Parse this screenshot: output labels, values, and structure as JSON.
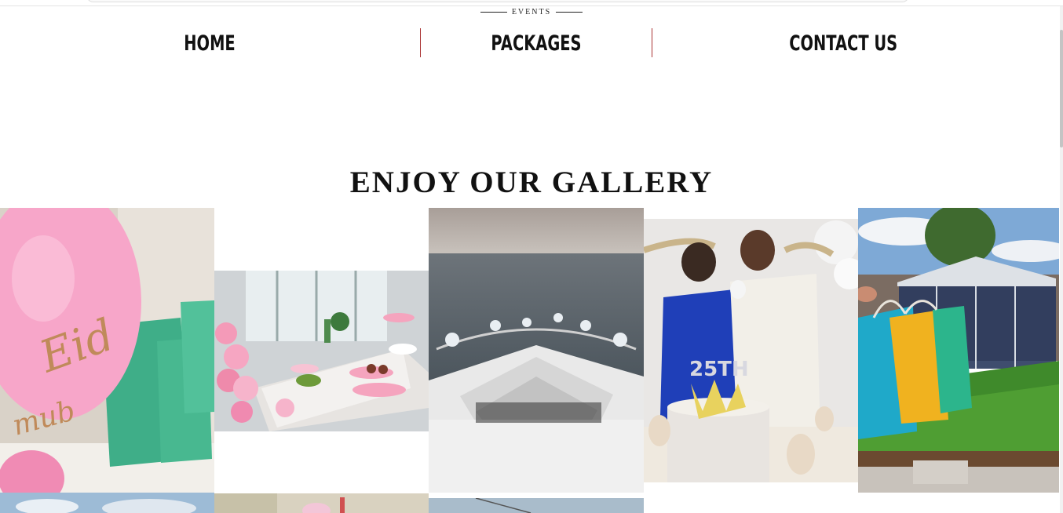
{
  "header": {
    "events_label": "EVENTS"
  },
  "nav": {
    "items": [
      {
        "label": "HOME"
      },
      {
        "label": "PACKAGES"
      },
      {
        "label": "CONTACT US"
      }
    ]
  },
  "gallery": {
    "title": "ENJOY OUR GALLERY",
    "images": [
      {
        "alt": "Eid balloon and green gift bags",
        "cake_text": "Eid"
      },
      {
        "alt": "Pink balloon dessert table"
      },
      {
        "alt": "Yacht bow with white balloons at sea"
      },
      {
        "alt": "Couple cutting 25th anniversary cake",
        "cake_text": "25TH"
      },
      {
        "alt": "Garden gazebo with colorful gift bags"
      }
    ]
  },
  "colors": {
    "accent_divider": "#aa3333",
    "text": "#111111"
  }
}
